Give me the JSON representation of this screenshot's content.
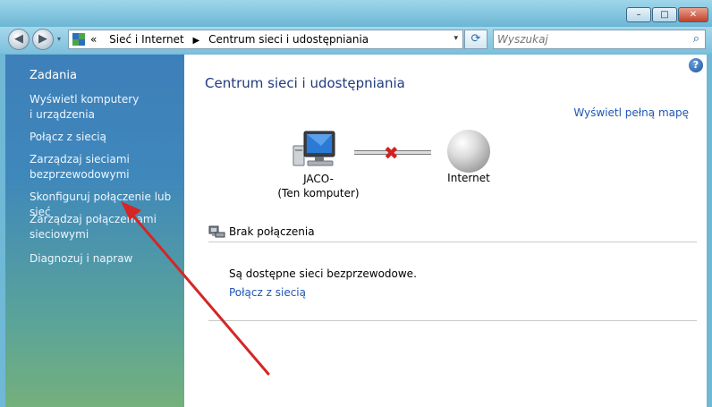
{
  "window": {
    "controls": {
      "minimize": "–",
      "maximize": "□",
      "close": "✕"
    }
  },
  "nav": {
    "back_glyph": "◀",
    "forward_glyph": "▶",
    "history_glyph": "▾",
    "address": {
      "chevrons": "«",
      "part1": "Sieć i Internet",
      "sep": "▶",
      "part2": "Centrum sieci i udostępniania",
      "dropdown": "▾"
    },
    "refresh_glyph": "⟳",
    "search": {
      "placeholder": "Wyszukaj",
      "glyph": "⌕"
    }
  },
  "sidebar": {
    "heading": "Zadania",
    "items": [
      {
        "label1": "Wyświetl komputery",
        "label2": "i urządzenia"
      },
      {
        "label1": "Połącz z siecią"
      },
      {
        "label1": "Zarządzaj sieciami",
        "label2": "bezprzewodowymi"
      },
      {
        "label1": "Skonfiguruj połączenie lub sieć"
      },
      {
        "label1": "Zarządzaj połączeniami",
        "label2": "sieciowymi"
      },
      {
        "label1": "Diagnozuj i napraw"
      }
    ]
  },
  "main": {
    "help_glyph": "?",
    "title": "Centrum sieci i udostępniania",
    "full_map_link": "Wyświetl pełną mapę",
    "computer_name": "JACO-",
    "computer_note": "(Ten komputer)",
    "disconnect_glyph": "✖",
    "internet_label": "Internet",
    "status": "Brak połączenia",
    "available": "Są dostępne sieci bezprzewodowe.",
    "connect_link": "Połącz z siecią"
  },
  "colors": {
    "sidebar_top": "#3d7fba",
    "sidebar_bottom": "#74b07c",
    "link": "#1f56b3",
    "title": "#1f3c7e",
    "annotation_arrow": "#d42626"
  },
  "icons": [
    "back-icon",
    "forward-icon",
    "network-folder-icon",
    "refresh-icon",
    "search-icon",
    "help-icon",
    "computer-icon",
    "disconnect-x-icon",
    "globe-icon",
    "network-status-icon"
  ]
}
